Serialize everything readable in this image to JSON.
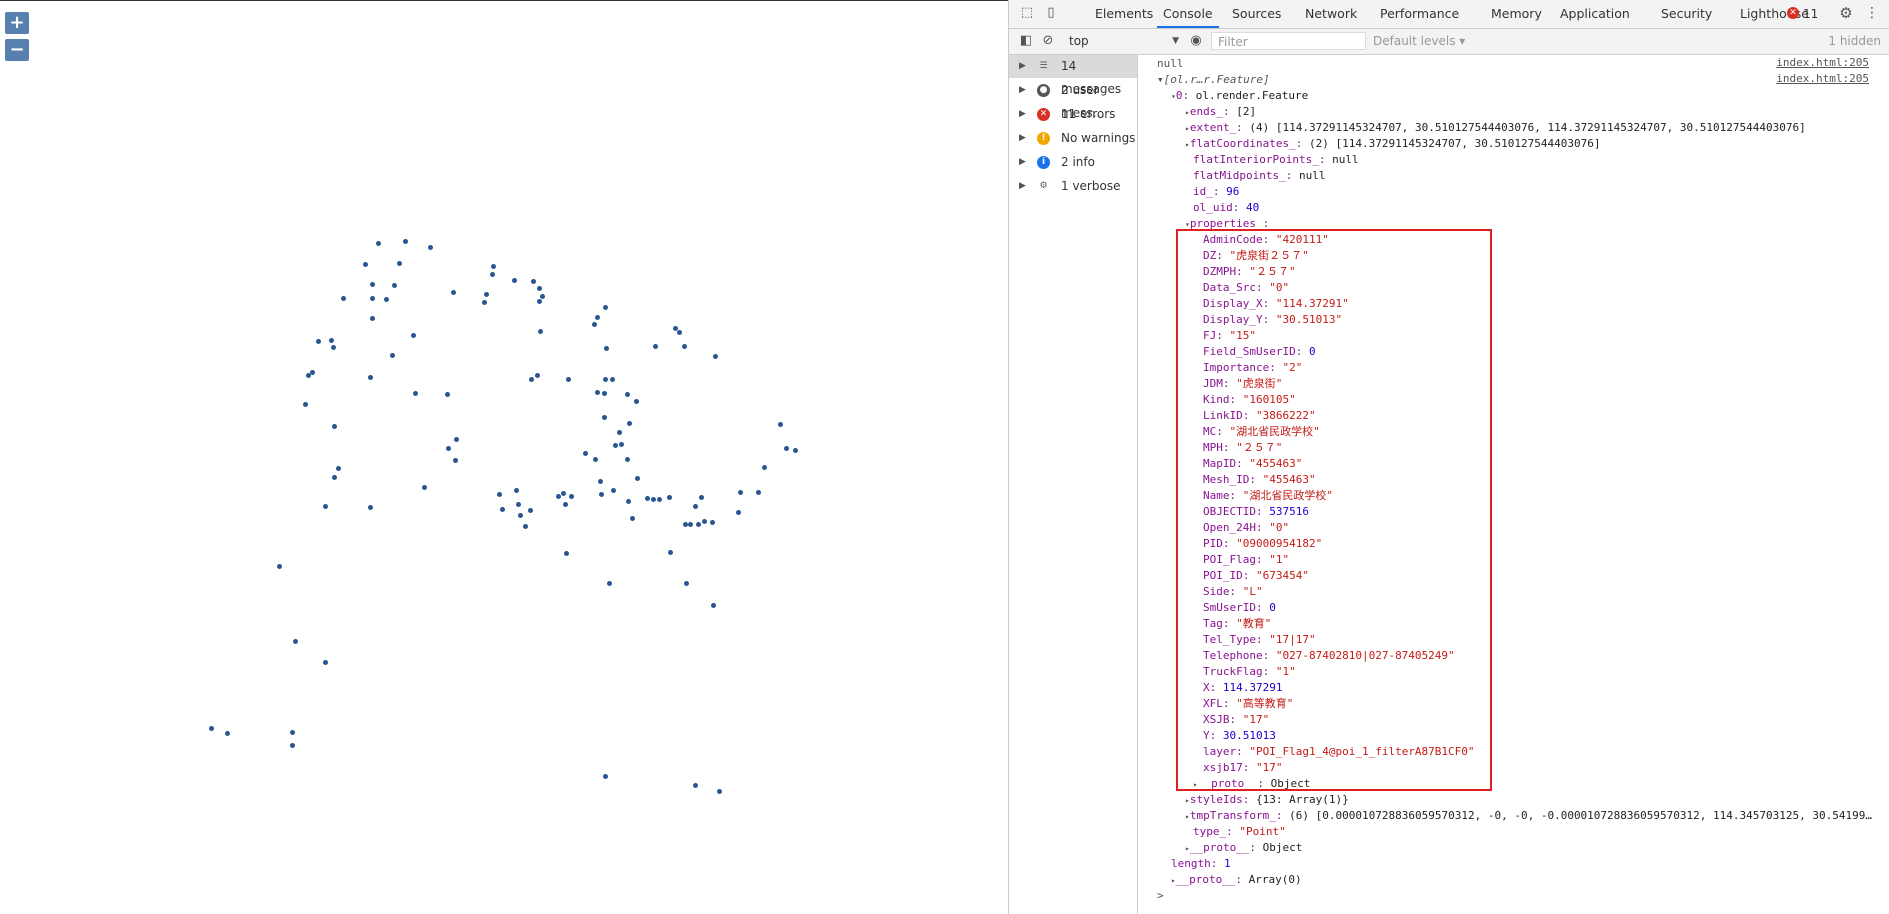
{
  "map": {
    "zoom_in_label": "+",
    "zoom_out_label": "−"
  },
  "devtools": {
    "tabs": [
      "Elements",
      "Console",
      "Sources",
      "Network",
      "Performance",
      "Memory",
      "Application",
      "Security",
      "Lighthouse"
    ],
    "active_tab": "Console",
    "error_count": "11",
    "context": "top",
    "filter_placeholder": "Filter",
    "levels": "Default levels ▾",
    "hidden": "1 hidden",
    "sidebar": [
      {
        "label": "14 messages",
        "icon": "list-icon"
      },
      {
        "label": "2 user mess…",
        "icon": "user-icon"
      },
      {
        "label": "11 errors",
        "icon": "error-icon"
      },
      {
        "label": "No warnings",
        "icon": "warning-icon"
      },
      {
        "label": "2 info",
        "icon": "info-icon"
      },
      {
        "label": "1 verbose",
        "icon": "gear-icon"
      }
    ],
    "source_link": "index.html:205",
    "console_lines": [
      {
        "text": "null",
        "indent": 0,
        "cls": "g"
      },
      {
        "text": "▾[ol.r…r.Feature]",
        "indent": 0,
        "cls": "g"
      },
      {
        "text": "▾0: ol.render.Feature",
        "indent": 1,
        "cls": ""
      },
      {
        "text": "▸ends_: [2]",
        "indent": 2,
        "cls": "k"
      },
      {
        "text": "▸extent_: (4) [114.37291145324707, 30.510127544403076, 114.37291145324707, 30.510127544403076]",
        "indent": 2,
        "cls": "k"
      },
      {
        "text": "▸flatCoordinates_: (2) [114.37291145324707, 30.510127544403076]",
        "indent": 2,
        "cls": "k"
      },
      {
        "text": "flatInteriorPoints_: null",
        "indent": 3,
        "cls": "k"
      },
      {
        "text": "flatMidpoints_: null",
        "indent": 3,
        "cls": "k"
      },
      {
        "text": "id_: 96",
        "indent": 3,
        "cls": "k"
      },
      {
        "text": "ol_uid: 40",
        "indent": 3,
        "cls": "k"
      },
      {
        "text": "▾properties_:",
        "indent": 2,
        "cls": "k"
      },
      {
        "text": "AdminCode: \"420111\"",
        "indent": 4,
        "cls": "k"
      },
      {
        "text": "DZ: \"虎泉街２５７\"",
        "indent": 4,
        "cls": "k"
      },
      {
        "text": "DZMPH: \"２５７\"",
        "indent": 4,
        "cls": "k"
      },
      {
        "text": "Data_Src: \"0\"",
        "indent": 4,
        "cls": "k"
      },
      {
        "text": "Display_X: \"114.37291\"",
        "indent": 4,
        "cls": "k"
      },
      {
        "text": "Display_Y: \"30.51013\"",
        "indent": 4,
        "cls": "k"
      },
      {
        "text": "FJ: \"15\"",
        "indent": 4,
        "cls": "k"
      },
      {
        "text": "Field_SmUserID: 0",
        "indent": 4,
        "cls": "k"
      },
      {
        "text": "Importance: \"2\"",
        "indent": 4,
        "cls": "k"
      },
      {
        "text": "JDM: \"虎泉街\"",
        "indent": 4,
        "cls": "k"
      },
      {
        "text": "Kind: \"160105\"",
        "indent": 4,
        "cls": "k"
      },
      {
        "text": "LinkID: \"3866222\"",
        "indent": 4,
        "cls": "k"
      },
      {
        "text": "MC: \"湖北省民政学校\"",
        "indent": 4,
        "cls": "k"
      },
      {
        "text": "MPH: \"２５７\"",
        "indent": 4,
        "cls": "k"
      },
      {
        "text": "MapID: \"455463\"",
        "indent": 4,
        "cls": "k"
      },
      {
        "text": "Mesh_ID: \"455463\"",
        "indent": 4,
        "cls": "k"
      },
      {
        "text": "Name: \"湖北省民政学校\"",
        "indent": 4,
        "cls": "k"
      },
      {
        "text": "OBJECTID: 537516",
        "indent": 4,
        "cls": "k"
      },
      {
        "text": "Open_24H: \"0\"",
        "indent": 4,
        "cls": "k"
      },
      {
        "text": "PID: \"09000954182\"",
        "indent": 4,
        "cls": "k"
      },
      {
        "text": "POI_Flag: \"1\"",
        "indent": 4,
        "cls": "k"
      },
      {
        "text": "POI_ID: \"673454\"",
        "indent": 4,
        "cls": "k"
      },
      {
        "text": "Side: \"L\"",
        "indent": 4,
        "cls": "k"
      },
      {
        "text": "SmUserID: 0",
        "indent": 4,
        "cls": "k"
      },
      {
        "text": "Tag: \"教育\"",
        "indent": 4,
        "cls": "k"
      },
      {
        "text": "Tel_Type: \"17|17\"",
        "indent": 4,
        "cls": "k"
      },
      {
        "text": "Telephone: \"027-87402810|027-87405249\"",
        "indent": 4,
        "cls": "k"
      },
      {
        "text": "TruckFlag: \"1\"",
        "indent": 4,
        "cls": "k"
      },
      {
        "text": "X: 114.37291",
        "indent": 4,
        "cls": "k"
      },
      {
        "text": "XFL: \"高等教育\"",
        "indent": 4,
        "cls": "k"
      },
      {
        "text": "XSJB: \"17\"",
        "indent": 4,
        "cls": "k"
      },
      {
        "text": "Y: 30.51013",
        "indent": 4,
        "cls": "k"
      },
      {
        "text": "layer: \"POI_Flag1_4@poi_1_filterA87B1CF0\"",
        "indent": 4,
        "cls": "k"
      },
      {
        "text": "xsjb17: \"17\"",
        "indent": 4,
        "cls": "k"
      },
      {
        "text": "▸__proto__: Object",
        "indent": 3,
        "cls": "k"
      },
      {
        "text": "▸styleIds: {13: Array(1)}",
        "indent": 2,
        "cls": "k"
      },
      {
        "text": "▸tmpTransform_: (6) [0.000010728836059570312, -0, -0, -0.000010728836059570312, 114.345703125, 30.54199…",
        "indent": 2,
        "cls": "k"
      },
      {
        "text": "type_: \"Point\"",
        "indent": 3,
        "cls": "k"
      },
      {
        "text": "▸__proto__: Object",
        "indent": 2,
        "cls": "k"
      },
      {
        "text": "length: 1",
        "indent": 1,
        "cls": "k"
      },
      {
        "text": "▸__proto__: Array(0)",
        "indent": 1,
        "cls": "k"
      },
      {
        "text": ">",
        "indent": 0,
        "cls": "g"
      }
    ]
  }
}
